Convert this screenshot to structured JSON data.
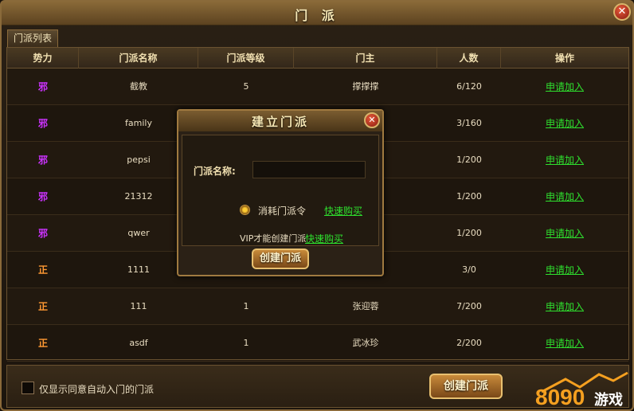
{
  "window": {
    "title": "门 派"
  },
  "tab": {
    "label": "门派列表"
  },
  "columns": [
    "势力",
    "门派名称",
    "门派等级",
    "门主",
    "人数",
    "操作"
  ],
  "rows": [
    {
      "faction": "邪",
      "faction_color": "#cc33ff",
      "name": "截教",
      "level": "5",
      "leader": "撑撑撑",
      "members": "6/120",
      "action": "申请加入"
    },
    {
      "faction": "邪",
      "faction_color": "#cc33ff",
      "name": "family",
      "level": "",
      "leader": "",
      "members": "3/160",
      "action": "申请加入"
    },
    {
      "faction": "邪",
      "faction_color": "#cc33ff",
      "name": "pepsi",
      "level": "",
      "leader": "",
      "members": "1/200",
      "action": "申请加入"
    },
    {
      "faction": "邪",
      "faction_color": "#cc33ff",
      "name": "21312",
      "level": "",
      "leader": "",
      "members": "1/200",
      "action": "申请加入"
    },
    {
      "faction": "邪",
      "faction_color": "#cc33ff",
      "name": "qwer",
      "level": "",
      "leader": "",
      "members": "1/200",
      "action": "申请加入"
    },
    {
      "faction": "正",
      "faction_color": "#ff9933",
      "name": "1111",
      "level": "",
      "leader": "",
      "members": "3/0",
      "action": "申请加入"
    },
    {
      "faction": "正",
      "faction_color": "#ff9933",
      "name": "111",
      "level": "1",
      "leader": "张迎蓉",
      "members": "7/200",
      "action": "申请加入"
    },
    {
      "faction": "正",
      "faction_color": "#ff9933",
      "name": "asdf",
      "level": "1",
      "leader": "武冰珍",
      "members": "2/200",
      "action": "申请加入"
    }
  ],
  "bottom": {
    "checkbox_label": "仅显示同意自动入门的门派",
    "create_button": "创建门派"
  },
  "dialog": {
    "title": "建立门派",
    "name_label": "门派名称:",
    "name_value": "",
    "radio_label": "消耗门派令",
    "buy_link_1": "快速购买",
    "vip_label": "VIP才能创建门派",
    "buy_link_2": "快速购买",
    "create_button": "创建门派"
  },
  "watermark": {
    "number": "8090",
    "text": "游戏"
  },
  "colors": {
    "link": "#2ee02e",
    "evil": "#cc33ff",
    "good": "#ff9933"
  }
}
